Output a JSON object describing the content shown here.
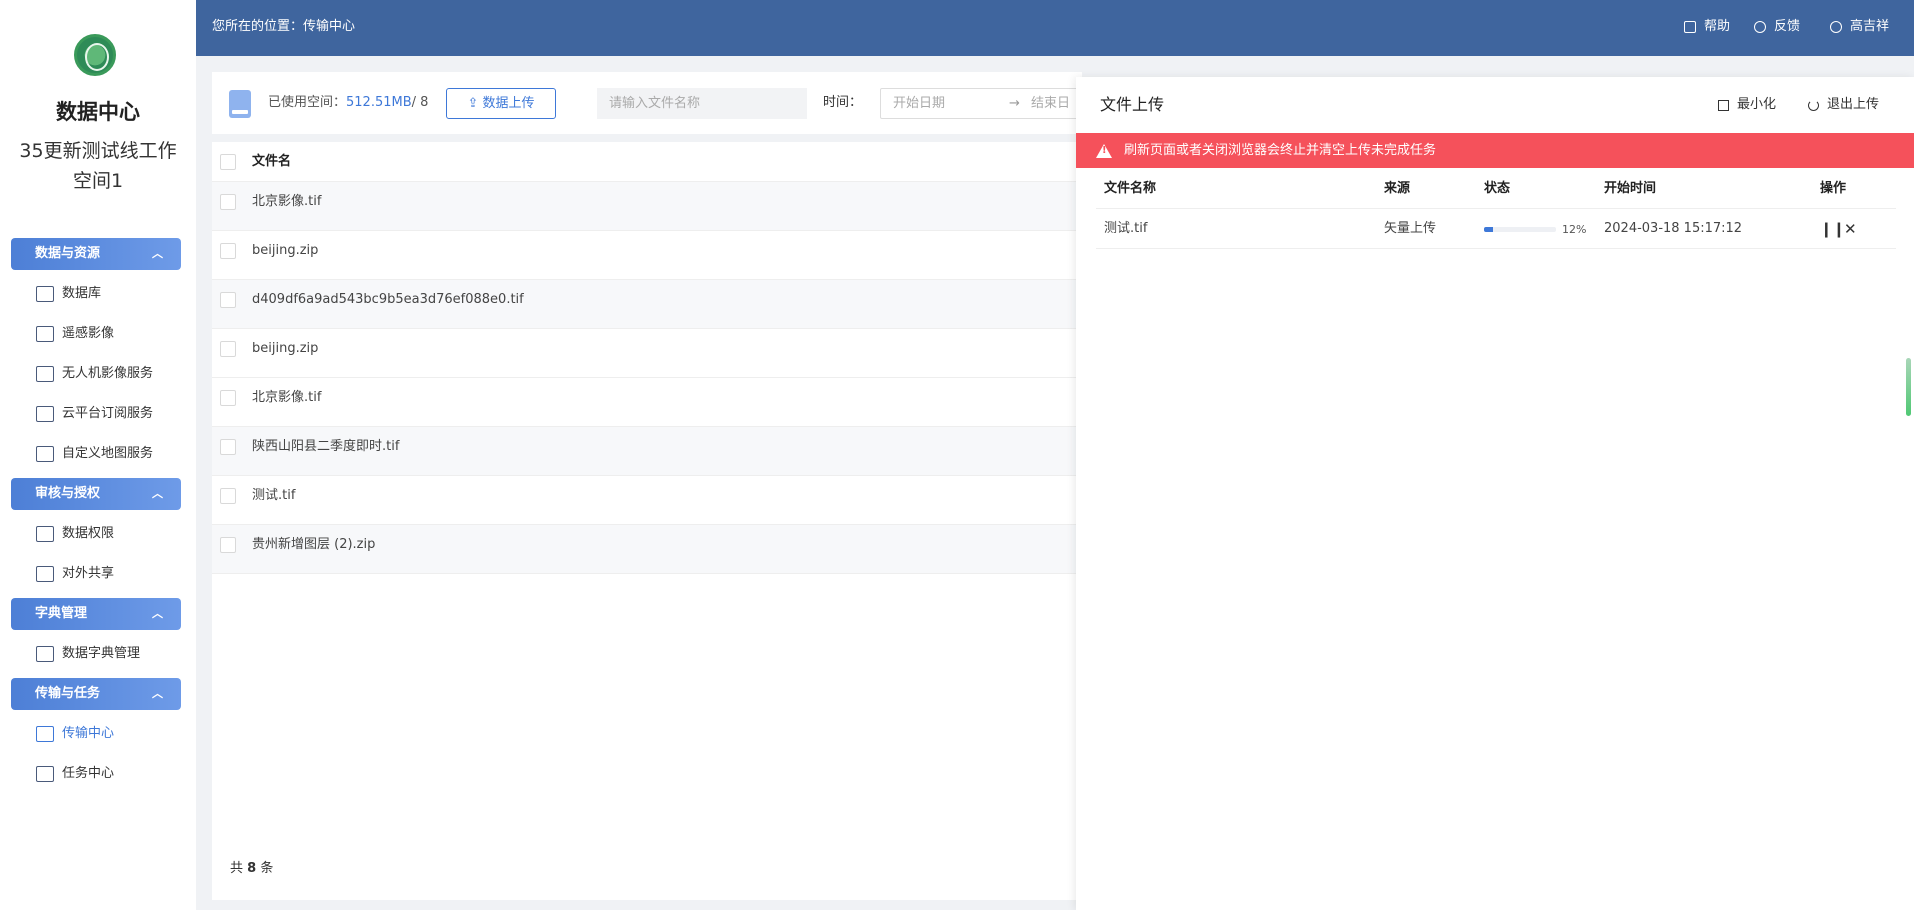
{
  "sidebar": {
    "title": "数据中心",
    "subtitle": "35更新测试线工作空间1",
    "groups": [
      {
        "label": "数据与资源",
        "items": [
          "数据库",
          "遥感影像",
          "无人机影像服务",
          "云平台订阅服务",
          "自定义地图服务"
        ]
      },
      {
        "label": "审核与授权",
        "items": [
          "数据权限",
          "对外共享"
        ]
      },
      {
        "label": "字典管理",
        "items": [
          "数据字典管理"
        ]
      },
      {
        "label": "传输与任务",
        "items": [
          "传输中心",
          "任务中心"
        ]
      }
    ],
    "active_item": "传输中心"
  },
  "header": {
    "breadcrumb": "您所在的位置：传输中心",
    "help": "帮助",
    "feedback": "反馈",
    "user": "高吉祥"
  },
  "toolbar": {
    "used_label": "已使用空间：",
    "used_value": "512.51MB",
    "used_total": "/ 8",
    "upload_button": "数据上传",
    "search_placeholder": "请输入文件名称",
    "time_label": "时间：",
    "start_date_placeholder": "开始日期",
    "range_arrow": "→",
    "end_date_placeholder": "结束日"
  },
  "file_table": {
    "header": "文件名",
    "rows": [
      "北京影像.tif",
      "beijing.zip",
      "d409df6a9ad543bc9b5ea3d76ef088e0.tif",
      "beijing.zip",
      "北京影像.tif",
      "陕西山阳县二季度即时.tif",
      "测试.tif",
      "贵州新增图层 (2).zip"
    ],
    "total_prefix": "共",
    "total_count": "8",
    "total_suffix": "条"
  },
  "upload_panel": {
    "title": "文件上传",
    "minimize": "最小化",
    "exit": "退出上传",
    "alert": "刷新页面或者关闭浏览器会终止并清空上传未完成任务",
    "columns": {
      "name": "文件名称",
      "source": "来源",
      "status": "状态",
      "start_time": "开始时间",
      "action": "操作"
    },
    "rows": [
      {
        "name": "测试.tif",
        "source": "矢量上传",
        "progress": 12,
        "progress_label": "12%",
        "start_time": "2024-03-18 15:17:12"
      }
    ]
  },
  "colors": {
    "header_bg": "#3f659e",
    "accent": "#3e78d8",
    "alert_bg": "#f5515b"
  }
}
